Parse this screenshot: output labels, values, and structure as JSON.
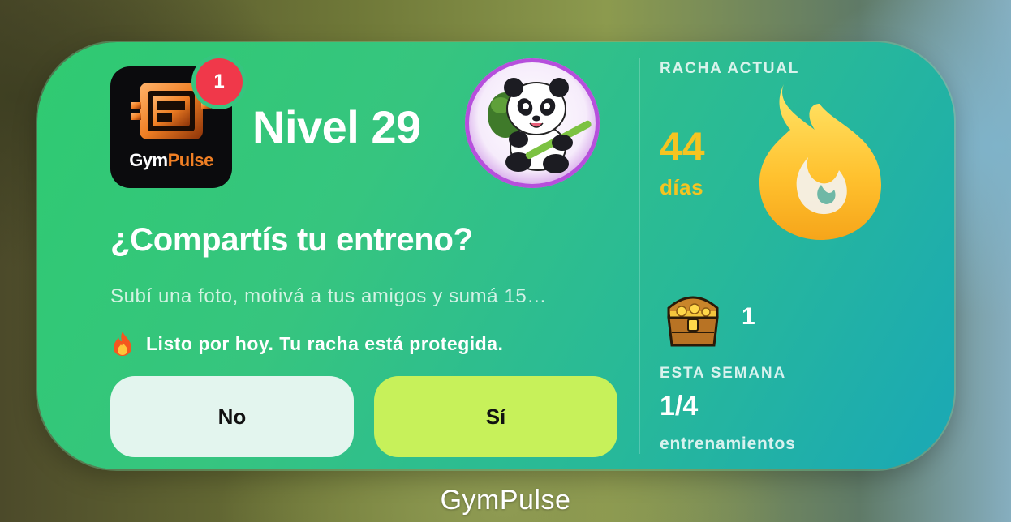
{
  "app": {
    "name_part1": "Gym",
    "name_part2": "Pulse",
    "notification_count": "1",
    "caption": "GymPulse",
    "icon": "gympulse-logo-icon",
    "brand_color": "#f07f24"
  },
  "header": {
    "level": "Nivel 29",
    "avatar": "panda-avatar"
  },
  "prompt": {
    "question": "¿Compartís tu entreno?",
    "subtitle": "Subí una foto, motivá a tus amigos y sumá 15…",
    "status_icon": "fire-icon",
    "status": "Listo por hoy. Tu racha está protegida."
  },
  "buttons": {
    "no": "No",
    "yes": "Sí"
  },
  "streak": {
    "label": "RACHA ACTUAL",
    "value": "44",
    "unit": "días",
    "icon": "flame-icon",
    "color": "#f5c421"
  },
  "rewards": {
    "icon": "treasure-chest-icon",
    "count": "1"
  },
  "week": {
    "label": "ESTA SEMANA",
    "value": "1/4",
    "unit": "entrenamientos"
  }
}
